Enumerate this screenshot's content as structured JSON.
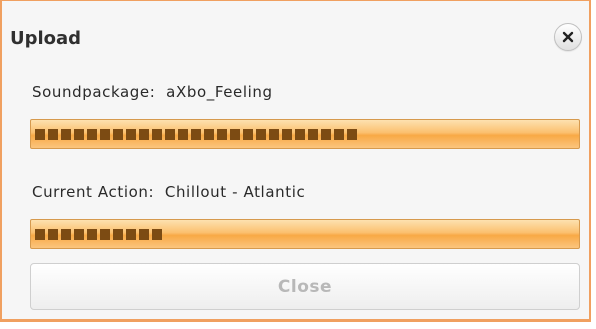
{
  "dialog": {
    "title": "Upload",
    "close_icon": "close-x-icon"
  },
  "soundpackage": {
    "label": "Soundpackage:  aXbo_Feeling",
    "progress": 0.61
  },
  "current_action": {
    "label": "Current Action:  Chillout - Atlantic",
    "progress": 0.25
  },
  "button": {
    "close_label": "Close",
    "enabled": false
  },
  "colors": {
    "border": "#f0a060",
    "bar_fill": "#7c4b13",
    "bar_track": "#f8a945",
    "title_text": "#303030",
    "disabled_text": "#b8b8b8"
  }
}
